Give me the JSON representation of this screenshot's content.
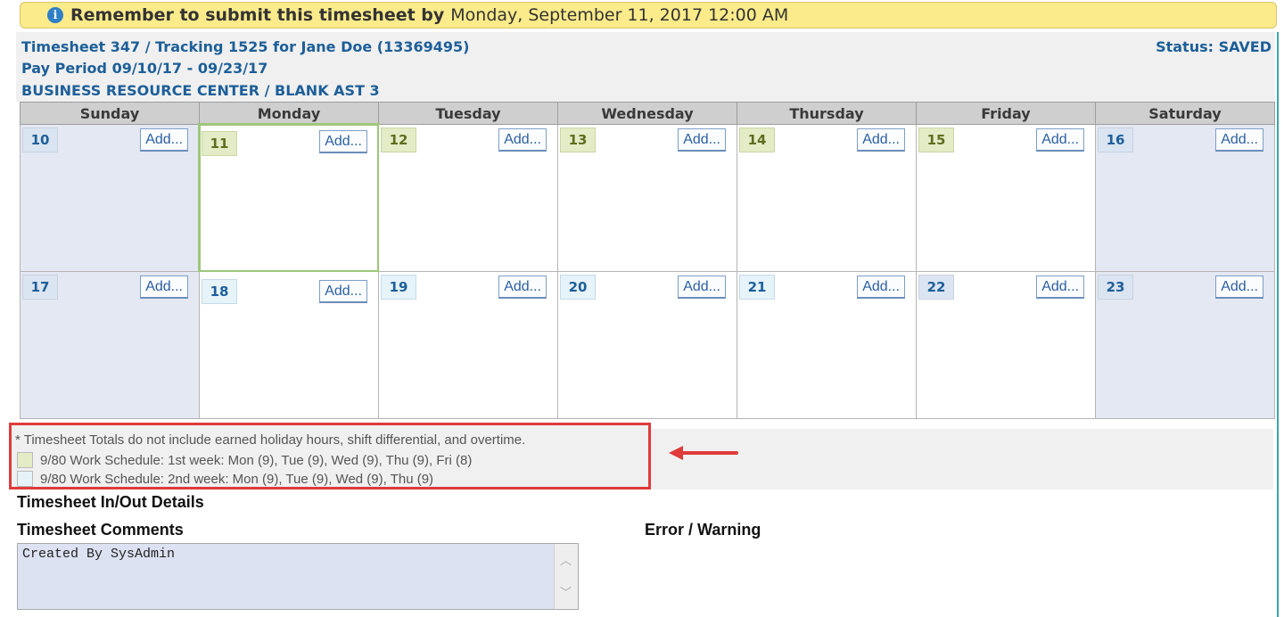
{
  "banner": {
    "bold": "Remember to submit this timesheet by",
    "date": "Monday, September 11, 2017 12:00 AM"
  },
  "header": {
    "line1": "Timesheet 347 / Tracking 1525 for Jane Doe (13369495)",
    "line2": "Pay Period 09/10/17 - 09/23/17",
    "line3": "BUSINESS RESOURCE CENTER / BLANK AST 3",
    "status": "Status: SAVED"
  },
  "calendar": {
    "days": [
      "Sunday",
      "Monday",
      "Tuesday",
      "Wednesday",
      "Thursday",
      "Friday",
      "Saturday"
    ],
    "week1": [
      "10",
      "11",
      "12",
      "13",
      "14",
      "15",
      "16"
    ],
    "week2": [
      "17",
      "18",
      "19",
      "20",
      "21",
      "22",
      "23"
    ],
    "add_label": "Add..."
  },
  "legend": {
    "note": "* Timesheet Totals do not include earned holiday hours, shift differential, and overtime.",
    "week1": "9/80 Work Schedule: 1st week: Mon (9), Tue (9), Wed (9), Thu (9), Fri (8)",
    "week2": "9/80 Work Schedule: 2nd week: Mon (9), Tue (9), Wed (9), Thu (9)",
    "week1_color": "#e3ecc6",
    "week2_color": "#e6f3f9"
  },
  "sections": {
    "inout": "Timesheet In/Out Details",
    "comments": "Timesheet Comments",
    "error": "Error / Warning"
  },
  "comments_value": "Created By SysAdmin",
  "icons": {
    "info": "info-icon",
    "arrow": "left-arrow-icon",
    "scroll_up": "chevron-up-icon",
    "scroll_down": "chevron-down-icon"
  }
}
